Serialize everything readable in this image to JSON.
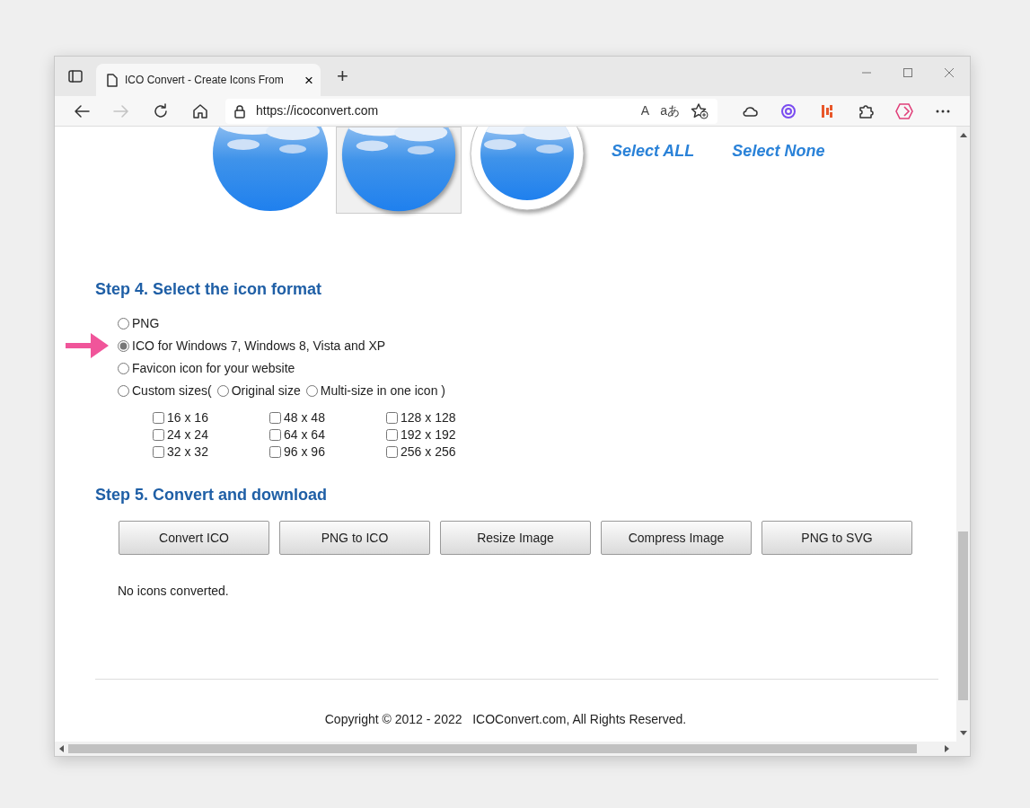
{
  "browser": {
    "tab_title": "ICO Convert - Create Icons From",
    "tab_close": "×",
    "new_tab": "+",
    "url": "https://icoconvert.com",
    "read_aloud": "A",
    "translate": "aあ",
    "forward_disabled": true
  },
  "previews": [
    {
      "kind": "plain",
      "selected": false
    },
    {
      "kind": "shadow",
      "selected": true
    },
    {
      "kind": "ring",
      "selected": false
    }
  ],
  "links": [
    "Select ALL",
    "Select None"
  ],
  "step4": {
    "heading": "Step 4. Select the icon format",
    "formats": [
      {
        "label": "PNG",
        "selected": false
      },
      {
        "label": "ICO for Windows 7, Windows 8, Vista and XP",
        "selected": true,
        "pointer": true
      },
      {
        "label": "Favicon icon for your website",
        "selected": false
      },
      {
        "label": "Custom sizes(",
        "selected": false,
        "options": [
          {
            "label": "Original size",
            "selected": false
          },
          {
            "label": "Multi-size in one icon )",
            "selected": false
          }
        ]
      }
    ],
    "sizes": [
      {
        "label": "16 x 16",
        "checked": false
      },
      {
        "label": "48 x 48",
        "checked": false
      },
      {
        "label": "128 x 128",
        "checked": false
      },
      {
        "label": "24 x 24",
        "checked": false
      },
      {
        "label": "64 x 64",
        "checked": false
      },
      {
        "label": "192 x 192",
        "checked": false
      },
      {
        "label": "32 x 32",
        "checked": false
      },
      {
        "label": "96 x 96",
        "checked": false
      },
      {
        "label": "256 x 256",
        "checked": false
      }
    ]
  },
  "step5": {
    "heading": "Step 5. Convert and download",
    "buttons": [
      "Convert ICO",
      "PNG to ICO",
      "Resize Image",
      "Compress Image",
      "PNG to SVG"
    ],
    "status": "No icons converted."
  },
  "footer": "Copyright © 2012 - 2022   ICOConvert.com, All Rights Reserved."
}
